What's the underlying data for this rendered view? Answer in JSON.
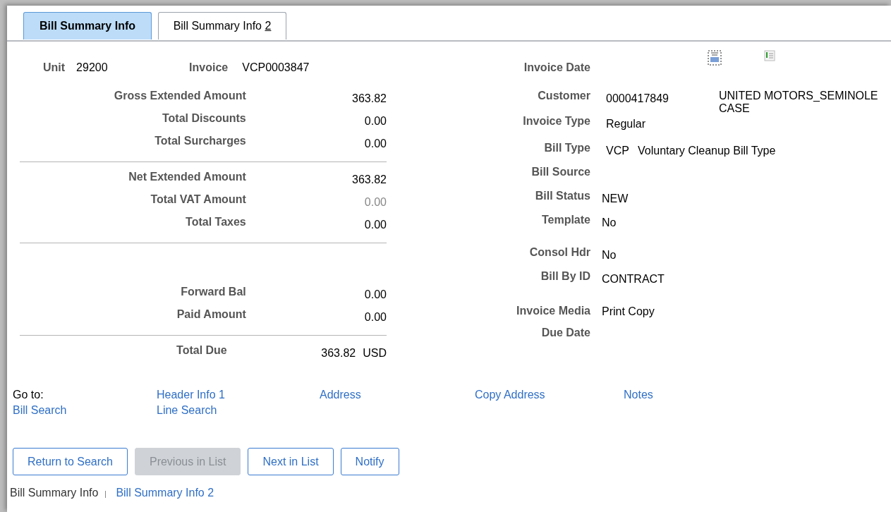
{
  "tabs": [
    {
      "label": "Bill Summary Info",
      "selected": true
    },
    {
      "label": "Bill Summary Info",
      "hotkey": "2",
      "selected": false
    }
  ],
  "header": [
    {
      "label": "Unit",
      "value": "29200"
    },
    {
      "label": "Invoice",
      "value": "VCP0003847"
    }
  ],
  "summary_sections": [
    {
      "rows": [
        {
          "label": "Gross Extended Amount",
          "value": "363.82",
          "disabled": false
        },
        {
          "label": "Total Discounts",
          "value": "0.00",
          "disabled": false
        },
        {
          "label": "Total Surcharges",
          "value": "0.00",
          "disabled": false
        }
      ]
    },
    {
      "rows": [
        {
          "label": "Net Extended Amount",
          "value": "363.82",
          "disabled": false
        },
        {
          "label": "Total VAT Amount",
          "value": "0.00",
          "disabled": true
        },
        {
          "label": "Total Taxes",
          "value": "0.00",
          "disabled": false
        }
      ]
    },
    {
      "rows": [
        {
          "label": "Forward Bal",
          "value": "0.00",
          "disabled": false
        },
        {
          "label": "Paid Amount",
          "value": "0.00",
          "disabled": false
        }
      ]
    },
    {
      "rows": [
        {
          "label": "Total Due",
          "value": "363.82",
          "currency": "USD",
          "disabled": false
        }
      ]
    }
  ],
  "details": [
    {
      "label": "Invoice Date"
    },
    {
      "label": "Customer",
      "value": "0000417849",
      "extra": "UNITED MOTORS_SEMINOLE CASE"
    },
    {
      "label": "Invoice Type",
      "value": "Regular"
    },
    {
      "label": "Bill Type",
      "value": "VCP",
      "extra": "Voluntary Cleanup Bill Type"
    },
    {
      "label": "Bill Source"
    },
    {
      "label": "Bill Status",
      "value": "NEW"
    },
    {
      "label": "Template",
      "value": "No"
    },
    {
      "label": "Consol Hdr",
      "value": "No"
    },
    {
      "label": "Bill By ID",
      "value": "CONTRACT"
    },
    {
      "label": "Invoice Media",
      "value": "Print Copy"
    },
    {
      "label": "Due Date"
    }
  ],
  "goto": {
    "label": "Go to:",
    "links": [
      "Header Info 1",
      "Address",
      "Copy Address",
      "Notes",
      "Bill Search",
      "Line Search"
    ]
  },
  "buttons": [
    {
      "label": "Return to Search",
      "disabled": false
    },
    {
      "label": "Previous in List",
      "disabled": true
    },
    {
      "label": "Next in List",
      "disabled": false
    },
    {
      "label": "Notify",
      "disabled": false
    }
  ],
  "page_links": [
    {
      "label": "Bill Summary Info",
      "selected": true
    },
    {
      "label": "Bill Summary Info 2",
      "selected": false
    }
  ]
}
